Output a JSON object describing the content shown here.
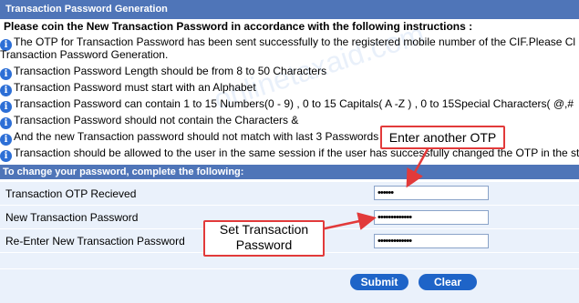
{
  "title_bar": "Transaction Password Generation",
  "instructions_heading": "Please coin the New Transaction Password in accordance with the following instructions :",
  "instructions": [
    "The OTP for Transaction Password has been sent successfully to the registered mobile number of the CIF.Please Cl",
    "Transaction Password Generation.",
    "Transaction Password Length should be from 8 to 50 Characters",
    "Transaction Password must start with an Alphabet",
    "Transaction Password can contain 1 to 15 Numbers(0 - 9) , 0 to 15 Capitals( A -Z ) , 0 to 15Special Characters( @,#",
    "Transaction Password should not contain the Characters &",
    "And the new Transaction password should not match with last 3 Passwords",
    "Transaction should be allowed to the user in the same session if the user has successfully changed the OTP in the st"
  ],
  "form": {
    "header": "To change your password, complete the following:",
    "otp_label": "Transaction OTP Recieved",
    "otp_value": "••••••",
    "new_label": "New Transaction Password",
    "new_value": "•••••••••••••",
    "reenter_label": "Re-Enter New Transaction Password",
    "reenter_value": "•••••••••••••"
  },
  "buttons": {
    "submit": "Submit",
    "clear": "Clear"
  },
  "callouts": {
    "otp": "Enter another OTP",
    "set": "Set Transaction Password"
  },
  "watermark": "onlinetaxaid.com",
  "colors": {
    "bar": "#4f75b8",
    "callout_border": "#e23a3a",
    "button": "#1e64c8"
  }
}
